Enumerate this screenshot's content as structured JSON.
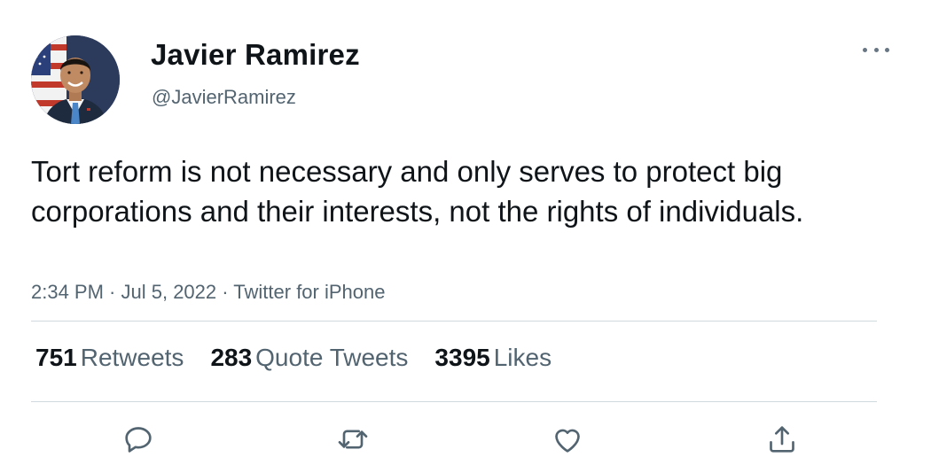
{
  "tweet": {
    "display_name": "Javier Ramirez",
    "handle": "@JavierRamirez",
    "text": "Tort reform is not necessary and only serves to protect big corporations and their interests, not the rights of individuals.",
    "time": "2:34 PM",
    "date": "Jul 5, 2022",
    "source": "Twitter for iPhone",
    "separator": " · "
  },
  "stats": {
    "retweets_count": "751",
    "retweets_label": "Retweets",
    "quotes_count": "283",
    "quotes_label": "Quote Tweets",
    "likes_count": "3395",
    "likes_label": "Likes"
  },
  "actions": [
    {
      "name": "reply",
      "icon": "reply-icon"
    },
    {
      "name": "retweet",
      "icon": "retweet-icon"
    },
    {
      "name": "like",
      "icon": "heart-icon"
    },
    {
      "name": "share",
      "icon": "share-icon"
    }
  ],
  "colors": {
    "text_primary": "#0f1419",
    "text_secondary": "#536471",
    "divider": "#cfd9de",
    "icon": "#536471"
  }
}
